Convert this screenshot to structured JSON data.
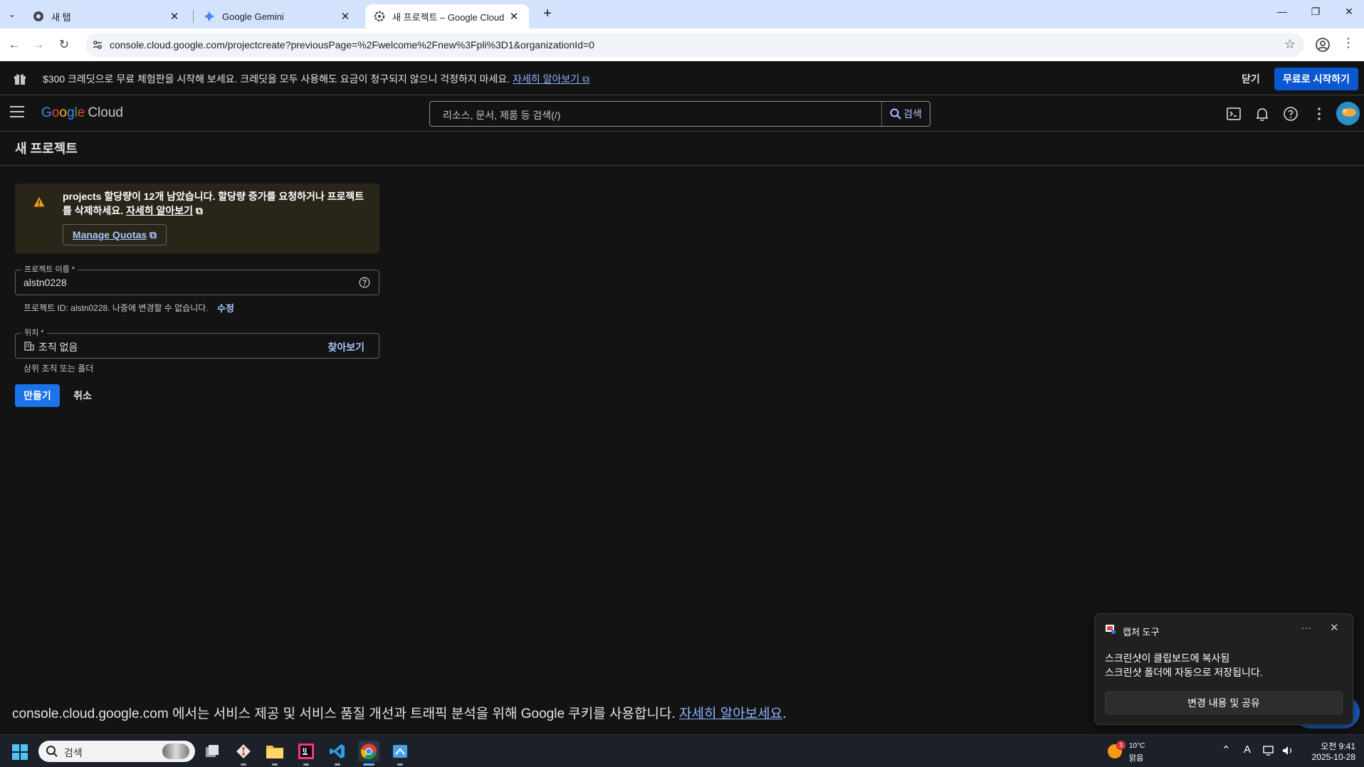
{
  "browser": {
    "tabs": [
      {
        "title": "새 탭",
        "icon": "chrome-icon"
      },
      {
        "title": "Google Gemini",
        "icon": "gemini-icon"
      },
      {
        "title": "새 프로젝트 – Google Cloud 콘",
        "icon": "gear-icon",
        "active": true
      }
    ],
    "new_tab": "+",
    "url": "console.cloud.google.com/projectcreate?previousPage=%2Fwelcome%2Fnew%3Fpli%3D1&organizationId=0"
  },
  "promo": {
    "text": "$300 크레딧으로 무료 체험판을 시작해 보세요. 크레딧을 모두 사용해도 요금이 청구되지 않으니 걱정하지 마세요.",
    "link": "자세히 알아보기",
    "close_label": "닫기",
    "start_label": "무료로 시작하기"
  },
  "header": {
    "logo_google": "Google",
    "logo_cloud": "Cloud",
    "search_placeholder": "리소스, 문서, 제품 등 검색(/)",
    "search_button": "검색"
  },
  "page": {
    "title": "새 프로젝트",
    "quota": {
      "text": "projects 할당량이 12개 남았습니다. 할당량 증가를 요청하거나 프로젝트를 삭제하세요.",
      "link": "자세히 알아보기",
      "manage_button": "Manage Quotas"
    },
    "project_name": {
      "label": "프로젝트 이름 *",
      "value": "alstn0228"
    },
    "project_id_hint": "프로젝트 ID: alstn0228. 나중에 변경할 수 없습니다.",
    "edit_link": "수정",
    "location": {
      "label": "위치 *",
      "value": "조직 없음",
      "browse": "찾아보기",
      "hint": "상위 조직 또는 폴더"
    },
    "create_button": "만들기",
    "cancel_button": "취소"
  },
  "cookie": {
    "text": "console.cloud.google.com 에서는 서비스 제공 및 서비스 품질 개선과 트래픽 분석을 위해 Google 쿠키를 사용합니다.",
    "link": "자세히 알아보세요",
    "end": "."
  },
  "toast": {
    "app": "캡처 도구",
    "line1": "스크린샷이 클립보드에 복사됨",
    "line2": "스크린샷 폴더에 자동으로 저장됩니다.",
    "action": "변경 내용 및 공유"
  },
  "taskbar": {
    "search": "검색",
    "weather_badge": "3",
    "temperature": "10°C",
    "condition": "맑음",
    "time": "오전 9:41",
    "date": "2025-10-28",
    "ime": "A"
  },
  "colors": {
    "accent": "#1a73e8",
    "link": "#8ab4f8",
    "background": "#131314",
    "warning": "#f29b12"
  }
}
